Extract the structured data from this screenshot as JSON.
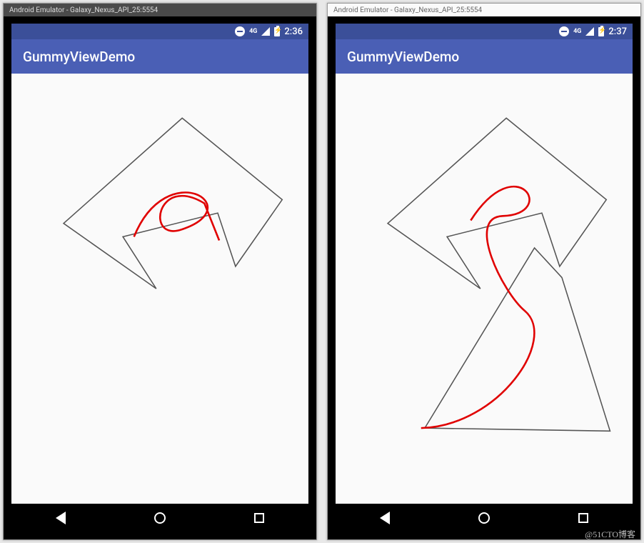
{
  "emulator": {
    "title": "Android Emulator - Galaxy_Nexus_API_25:5554"
  },
  "left": {
    "clock": "2:36",
    "signal_label": "4G",
    "app_title": "GummyViewDemo"
  },
  "right": {
    "clock": "2:37",
    "signal_label": "4G",
    "app_title": "GummyViewDemo"
  },
  "watermark": "@51CTO博客",
  "colors": {
    "status_bar": "#3b4f99",
    "app_bar": "#4a5fb5",
    "stroke_black": "#555",
    "stroke_red": "#e00000"
  }
}
